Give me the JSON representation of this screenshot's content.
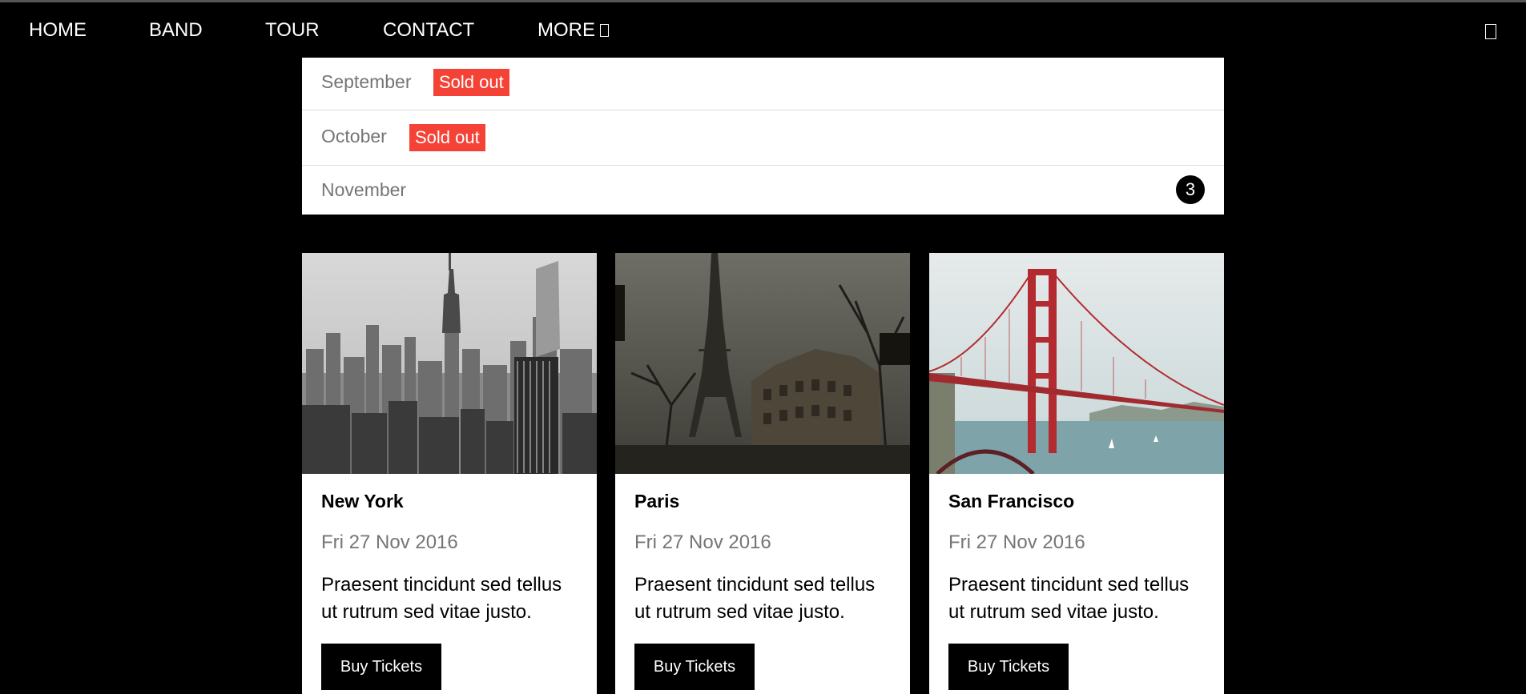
{
  "nav": {
    "items": [
      {
        "label": "HOME"
      },
      {
        "label": "BAND"
      },
      {
        "label": "TOUR"
      },
      {
        "label": "CONTACT"
      },
      {
        "label": "MORE"
      }
    ],
    "search_icon": "search-icon"
  },
  "months": [
    {
      "label": "September",
      "badge": "Sold out"
    },
    {
      "label": "October",
      "badge": "Sold out"
    },
    {
      "label": "November",
      "count": "3"
    }
  ],
  "cards": [
    {
      "title": "New York",
      "date": "Fri 27 Nov 2016",
      "description": "Praesent tincidunt sed tellus ut rutrum sed vitae justo.",
      "button": "Buy Tickets",
      "image": "new-york-skyline"
    },
    {
      "title": "Paris",
      "date": "Fri 27 Nov 2016",
      "description": "Praesent tincidunt sed tellus ut rutrum sed vitae justo.",
      "button": "Buy Tickets",
      "image": "paris-eiffel-tower"
    },
    {
      "title": "San Francisco",
      "date": "Fri 27 Nov 2016",
      "description": "Praesent tincidunt sed tellus ut rutrum sed vitae justo.",
      "button": "Buy Tickets",
      "image": "golden-gate-bridge"
    }
  ],
  "colors": {
    "background": "#000000",
    "sold_out_badge": "#f44336",
    "muted_text": "#757575",
    "card_background": "#ffffff"
  }
}
